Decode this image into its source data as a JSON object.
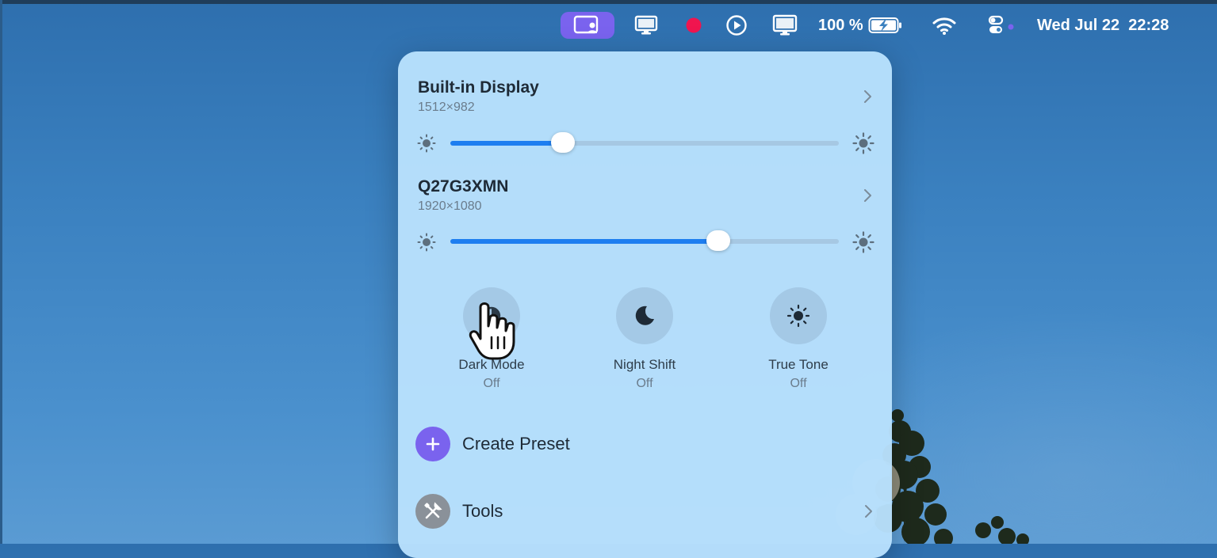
{
  "menubar": {
    "battery_percent": "100 %",
    "datetime": "Wed Jul 22  22:28"
  },
  "panel": {
    "displays": [
      {
        "name": "Built-in Display",
        "resolution": "1512×982",
        "brightness": 0.29
      },
      {
        "name": "Q27G3XMN",
        "resolution": "1920×1080",
        "brightness": 0.69
      }
    ],
    "toggles": [
      {
        "label": "Dark Mode",
        "state": "Off",
        "icon": "dark-mode-icon"
      },
      {
        "label": "Night Shift",
        "state": "Off",
        "icon": "moon-icon"
      },
      {
        "label": "True Tone",
        "state": "Off",
        "icon": "sun-icon"
      }
    ],
    "actions": {
      "create_preset": "Create Preset",
      "tools": "Tools"
    }
  },
  "colors": {
    "accent": "#7a63ee",
    "slider_fill": "#1e7ef0",
    "panel_bg": "#b8e0fc",
    "record_dot": "#f0154f"
  }
}
